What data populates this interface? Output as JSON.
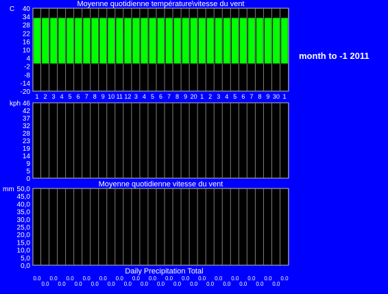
{
  "side_label": "month to -1 2011",
  "colors": {
    "background": "#0000ff",
    "plot_bg": "#000000",
    "bar_fill": "#00ff00",
    "grid": "#808080",
    "text": "#ffffff"
  },
  "chart_data": [
    {
      "type": "bar",
      "title": "Moyenne quotidienne température\\vitesse du vent",
      "unit": "C",
      "ylim": [
        -20,
        40
      ],
      "yticks": [
        "40",
        "34",
        "28",
        "22",
        "16",
        "10",
        "4",
        "-2",
        "-8",
        "-14",
        "-20"
      ],
      "categories": [
        "1",
        "2",
        "3",
        "4",
        "5",
        "6",
        "7",
        "8",
        "9",
        "10",
        "11",
        "12",
        "3",
        "4",
        "5",
        "6",
        "7",
        "8",
        "9",
        "20",
        "1",
        "2",
        "3",
        "4",
        "5",
        "6",
        "7",
        "8",
        "9",
        "30",
        "1"
      ],
      "values": [
        33,
        33,
        33,
        33,
        33,
        33,
        33,
        33,
        33,
        33,
        33,
        33,
        33,
        33,
        33,
        33,
        33,
        33,
        33,
        33,
        33,
        33,
        33,
        33,
        33,
        33,
        33,
        33,
        33,
        33,
        33
      ]
    },
    {
      "type": "bar",
      "title": "",
      "unit": "kph",
      "ylim": [
        0,
        46
      ],
      "yticks": [
        "46",
        "42",
        "37",
        "32",
        "28",
        "23",
        "19",
        "14",
        "9",
        "5",
        "0"
      ],
      "categories": [],
      "values": [
        0,
        0,
        0,
        0,
        0,
        0,
        0,
        0,
        0,
        0,
        0,
        0,
        0,
        0,
        0,
        0,
        0,
        0,
        0,
        0,
        0,
        0,
        0,
        0,
        0,
        0,
        0,
        0,
        0,
        0,
        0
      ]
    },
    {
      "type": "bar",
      "title": "Moyenne quotidienne vitesse du vent",
      "xlabel": "Daily Precipitation Total",
      "unit": "mm",
      "ylim": [
        0,
        50
      ],
      "yticks": [
        "50,0",
        "45,0",
        "40,0",
        "35,0",
        "30,0",
        "25,0",
        "20,0",
        "15,0",
        "10,0",
        "5,0",
        "0,0"
      ],
      "categories": [],
      "values": [
        0,
        0,
        0,
        0,
        0,
        0,
        0,
        0,
        0,
        0,
        0,
        0,
        0,
        0,
        0,
        0,
        0,
        0,
        0,
        0,
        0,
        0,
        0,
        0,
        0,
        0,
        0,
        0,
        0,
        0,
        0
      ],
      "value_labels": [
        "0.0",
        "0.0",
        "0.0",
        "0.0",
        "0.0",
        "0.0",
        "0.0",
        "0.0",
        "0.0",
        "0.0",
        "0.0",
        "0.0",
        "0.0",
        "0.0",
        "0.0",
        "0.0",
        "0.0",
        "0.0",
        "0.0",
        "0.0",
        "0.0",
        "0.0",
        "0.0",
        "0.0",
        "0.0",
        "0.0",
        "0.0",
        "0.0",
        "0.0",
        "0.0",
        "0.0"
      ]
    }
  ]
}
